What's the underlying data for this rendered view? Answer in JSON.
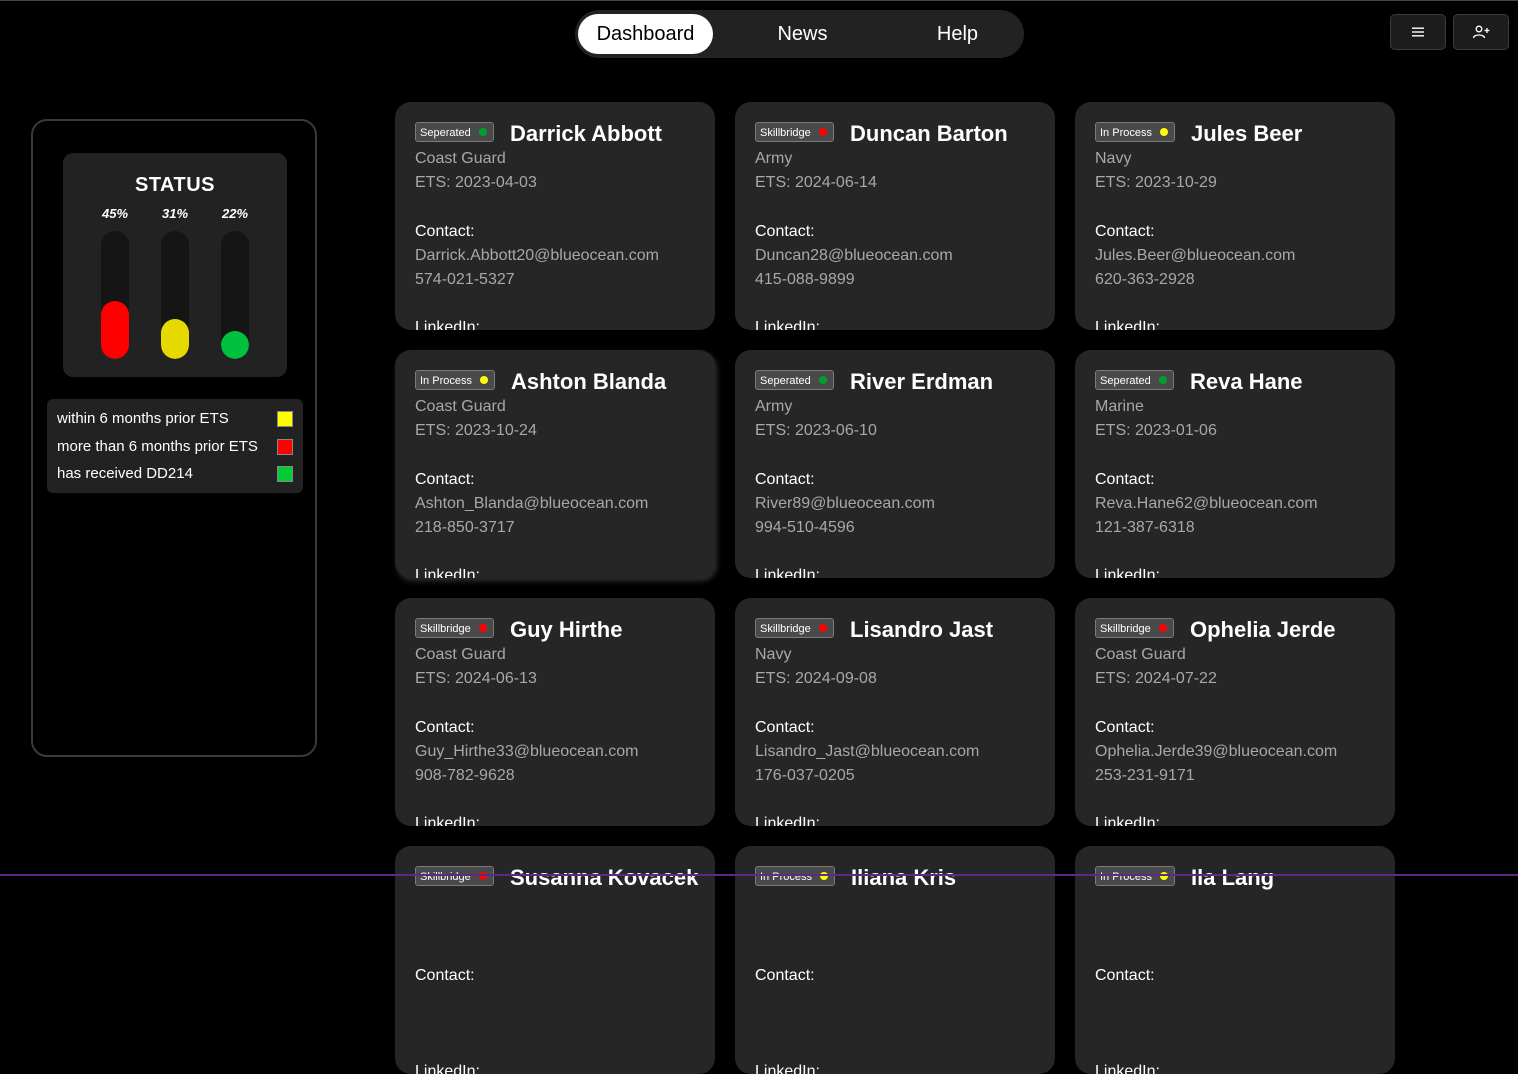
{
  "nav": {
    "tabs": [
      "Dashboard",
      "News",
      "Help"
    ],
    "active": 0
  },
  "header_buttons": {
    "menu_icon": "hamburger-icon",
    "add_user_icon": "add-user-icon"
  },
  "status": {
    "title": "STATUS",
    "bars": [
      {
        "pct_label": "45%",
        "level": 0.45,
        "color": "#ff0000"
      },
      {
        "pct_label": "31%",
        "level": 0.31,
        "color": "#e6d900"
      },
      {
        "pct_label": "22%",
        "level": 0.22,
        "color": "#00c040"
      }
    ],
    "legend": [
      {
        "label": "within 6 months prior ETS",
        "color": "#ffff00"
      },
      {
        "label": "more than 6 months prior ETS",
        "color": "#ff0000"
      },
      {
        "label": "has received DD214",
        "color": "#00cc33"
      }
    ]
  },
  "labels": {
    "contact": "Contact:",
    "linkedin": "LinkedIn:"
  },
  "cards": [
    {
      "status": "Seperated",
      "dot": "#00a030",
      "name": "Darrick Abbott",
      "branch": "Coast Guard",
      "ets": "ETS: 2023-04-03",
      "email": "Darrick.Abbott20@blueocean.com",
      "phone": "574-021-5327"
    },
    {
      "status": "Skillbridge",
      "dot": "#ff0000",
      "name": "Duncan Barton",
      "branch": "Army",
      "ets": "ETS: 2024-06-14",
      "email": "Duncan28@blueocean.com",
      "phone": "415-088-9899"
    },
    {
      "status": "In Process",
      "dot": "#ffff00",
      "name": "Jules Beer",
      "branch": "Navy",
      "ets": "ETS: 2023-10-29",
      "email": "Jules.Beer@blueocean.com",
      "phone": "620-363-2928"
    },
    {
      "status": "In Process",
      "dot": "#ffff00",
      "name": "Ashton Blanda",
      "branch": "Coast Guard",
      "ets": "ETS: 2023-10-24",
      "email": "Ashton_Blanda@blueocean.com",
      "phone": "218-850-3717"
    },
    {
      "status": "Seperated",
      "dot": "#00a030",
      "name": "River Erdman",
      "branch": "Army",
      "ets": "ETS: 2023-06-10",
      "email": "River89@blueocean.com",
      "phone": "994-510-4596"
    },
    {
      "status": "Seperated",
      "dot": "#00a030",
      "name": "Reva Hane",
      "branch": "Marine",
      "ets": "ETS: 2023-01-06",
      "email": "Reva.Hane62@blueocean.com",
      "phone": "121-387-6318"
    },
    {
      "status": "Skillbridge",
      "dot": "#ff0000",
      "name": "Guy Hirthe",
      "branch": "Coast Guard",
      "ets": "ETS: 2024-06-13",
      "email": "Guy_Hirthe33@blueocean.com",
      "phone": "908-782-9628"
    },
    {
      "status": "Skillbridge",
      "dot": "#ff0000",
      "name": "Lisandro Jast",
      "branch": "Navy",
      "ets": "ETS: 2024-09-08",
      "email": "Lisandro_Jast@blueocean.com",
      "phone": "176-037-0205"
    },
    {
      "status": "Skillbridge",
      "dot": "#ff0000",
      "name": "Ophelia Jerde",
      "branch": "Coast Guard",
      "ets": "ETS: 2024-07-22",
      "email": "Ophelia.Jerde39@blueocean.com",
      "phone": "253-231-9171"
    },
    {
      "status": "Skillbridge",
      "dot": "#ff0000",
      "name": "Susanna Kovacek",
      "branch": "",
      "ets": "",
      "email": "",
      "phone": ""
    },
    {
      "status": "In Process",
      "dot": "#ffff00",
      "name": "Iliana Kris",
      "branch": "",
      "ets": "",
      "email": "",
      "phone": ""
    },
    {
      "status": "In Process",
      "dot": "#ffff00",
      "name": "Ila Lang",
      "branch": "",
      "ets": "",
      "email": "",
      "phone": ""
    }
  ]
}
